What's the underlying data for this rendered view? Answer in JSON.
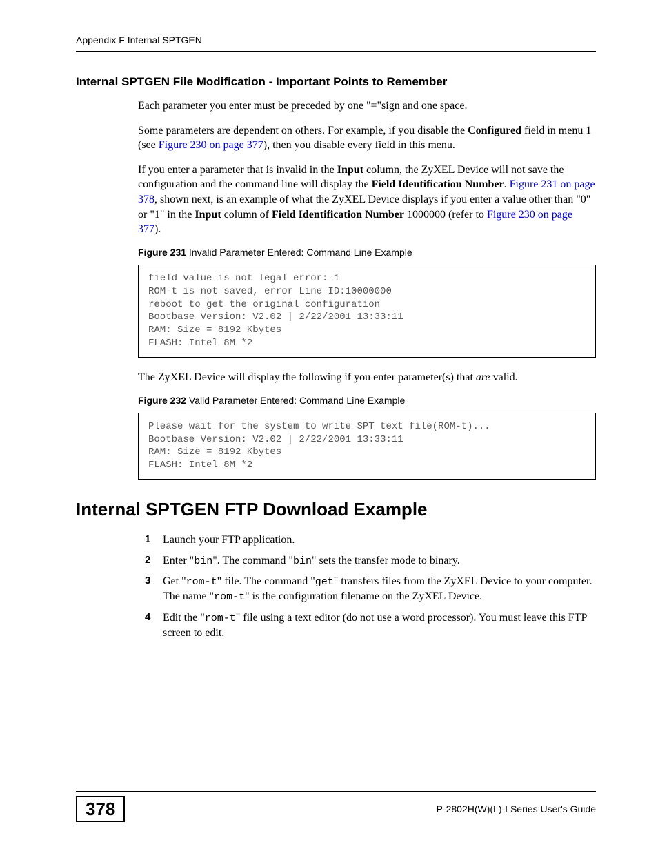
{
  "header": "Appendix F Internal SPTGEN",
  "subheading": "Internal SPTGEN File Modification - Important Points to Remember",
  "para1": "Each parameter you enter must be preceded by one \"=\"sign and one space.",
  "para2a": "Some parameters are dependent on others. For example, if you disable the ",
  "para2b": "Configured",
  "para2c": " field in menu 1 (see ",
  "para2link1": "Figure 230 on page 377",
  "para2d": "), then you disable every field in this menu.",
  "para3a": "If you enter a parameter that is invalid in the ",
  "para3b": "Input",
  "para3c": " column, the ZyXEL Device will not save the configuration and the command line will display the ",
  "para3d": "Field Identification Number",
  "para3e": ". ",
  "para3link1": "Figure 231 on page 378",
  "para3f": ", shown next, is an example of what the ZyXEL Device displays if you enter a value other than \"0\" or \"1\" in the ",
  "para3g": "Input",
  "para3h": " column of ",
  "para3i": "Field Identification Number",
  "para3j": " 1000000 (refer to ",
  "para3link2": "Figure 230 on page 377",
  "para3k": ").",
  "fig231num": "Figure 231",
  "fig231cap": "   Invalid Parameter Entered: Command Line Example",
  "code1": "field value is not legal error:-1\nROM-t is not saved, error Line ID:10000000\nreboot to get the original configuration\nBootbase Version: V2.02 | 2/22/2001 13:33:11\nRAM: Size = 8192 Kbytes\nFLASH: Intel 8M *2",
  "para4a": "The ZyXEL Device will display the following if you enter parameter(s) that ",
  "para4b": "are",
  "para4c": " valid.",
  "fig232num": "Figure 232",
  "fig232cap": "   Valid Parameter Entered: Command Line Example",
  "code2": "Please wait for the system to write SPT text file(ROM-t)...\nBootbase Version: V2.02 | 2/22/2001 13:33:11\nRAM: Size = 8192 Kbytes\nFLASH: Intel 8M *2",
  "section2": "Internal SPTGEN FTP Download Example",
  "steps": {
    "s1": "Launch your FTP application.",
    "s2a": "Enter \"",
    "s2b": "bin",
    "s2c": "\". The command \"",
    "s2d": "bin",
    "s2e": "\" sets the transfer mode to binary.",
    "s3a": "Get \"",
    "s3b": "rom-t",
    "s3c": "\" file. The command \"",
    "s3d": "get",
    "s3e": "\" transfers files from the ZyXEL Device to your computer. The name \"",
    "s3f": "rom-t",
    "s3g": "\" is the configuration filename on the ZyXEL Device.",
    "s4a": "Edit the \"",
    "s4b": "rom-t",
    "s4c": "\" file using a text editor (do not use a word processor). You must leave this FTP screen to edit."
  },
  "nums": {
    "n1": "1",
    "n2": "2",
    "n3": "3",
    "n4": "4"
  },
  "pagenum": "378",
  "footerright": "P-2802H(W)(L)-I Series User's Guide"
}
